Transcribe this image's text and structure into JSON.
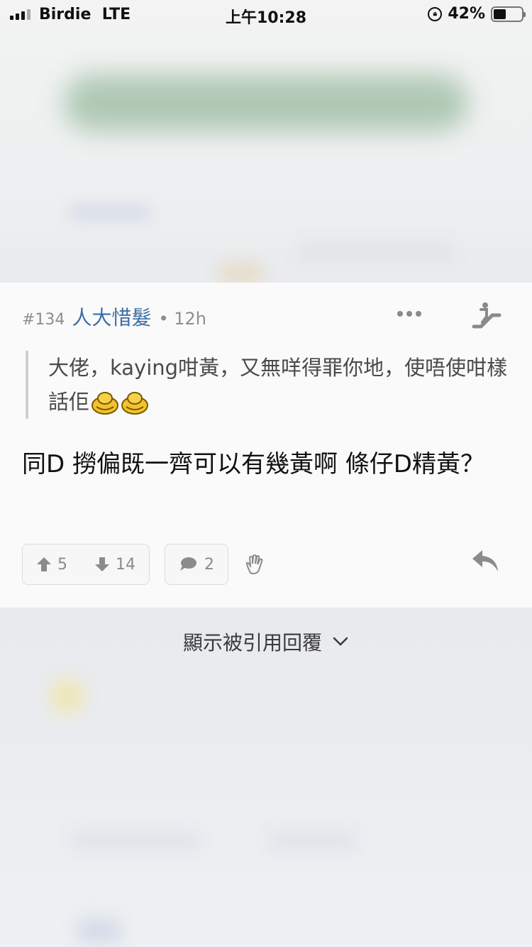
{
  "status_bar": {
    "carrier": "Birdie",
    "network": "LTE",
    "time": "上午10:28",
    "battery": "42%"
  },
  "post": {
    "number": "#134",
    "username": "人大惜髮",
    "time": "• 12h",
    "quote_text": "大佬，kaying咁黃，又無咩得罪你地，使唔使咁樣話佢",
    "body_text": "同D 撈偏既一齊可以有幾黃啊 條仔D精黃？",
    "upvotes": "5",
    "downvotes": "14",
    "comments": "2"
  },
  "show_quoted_label": "顯示被引用回覆",
  "icons": {
    "more": "more-icon",
    "escalator": "escalator-icon",
    "upvote": "arrow-up-icon",
    "downvote": "arrow-down-icon",
    "comment": "comment-icon",
    "hand": "hand-icon",
    "reply": "reply-icon",
    "chevron": "chevron-down-icon"
  },
  "colors": {
    "username": "#3b6ea5",
    "background": "#eceef1",
    "card": "#fafafa"
  }
}
